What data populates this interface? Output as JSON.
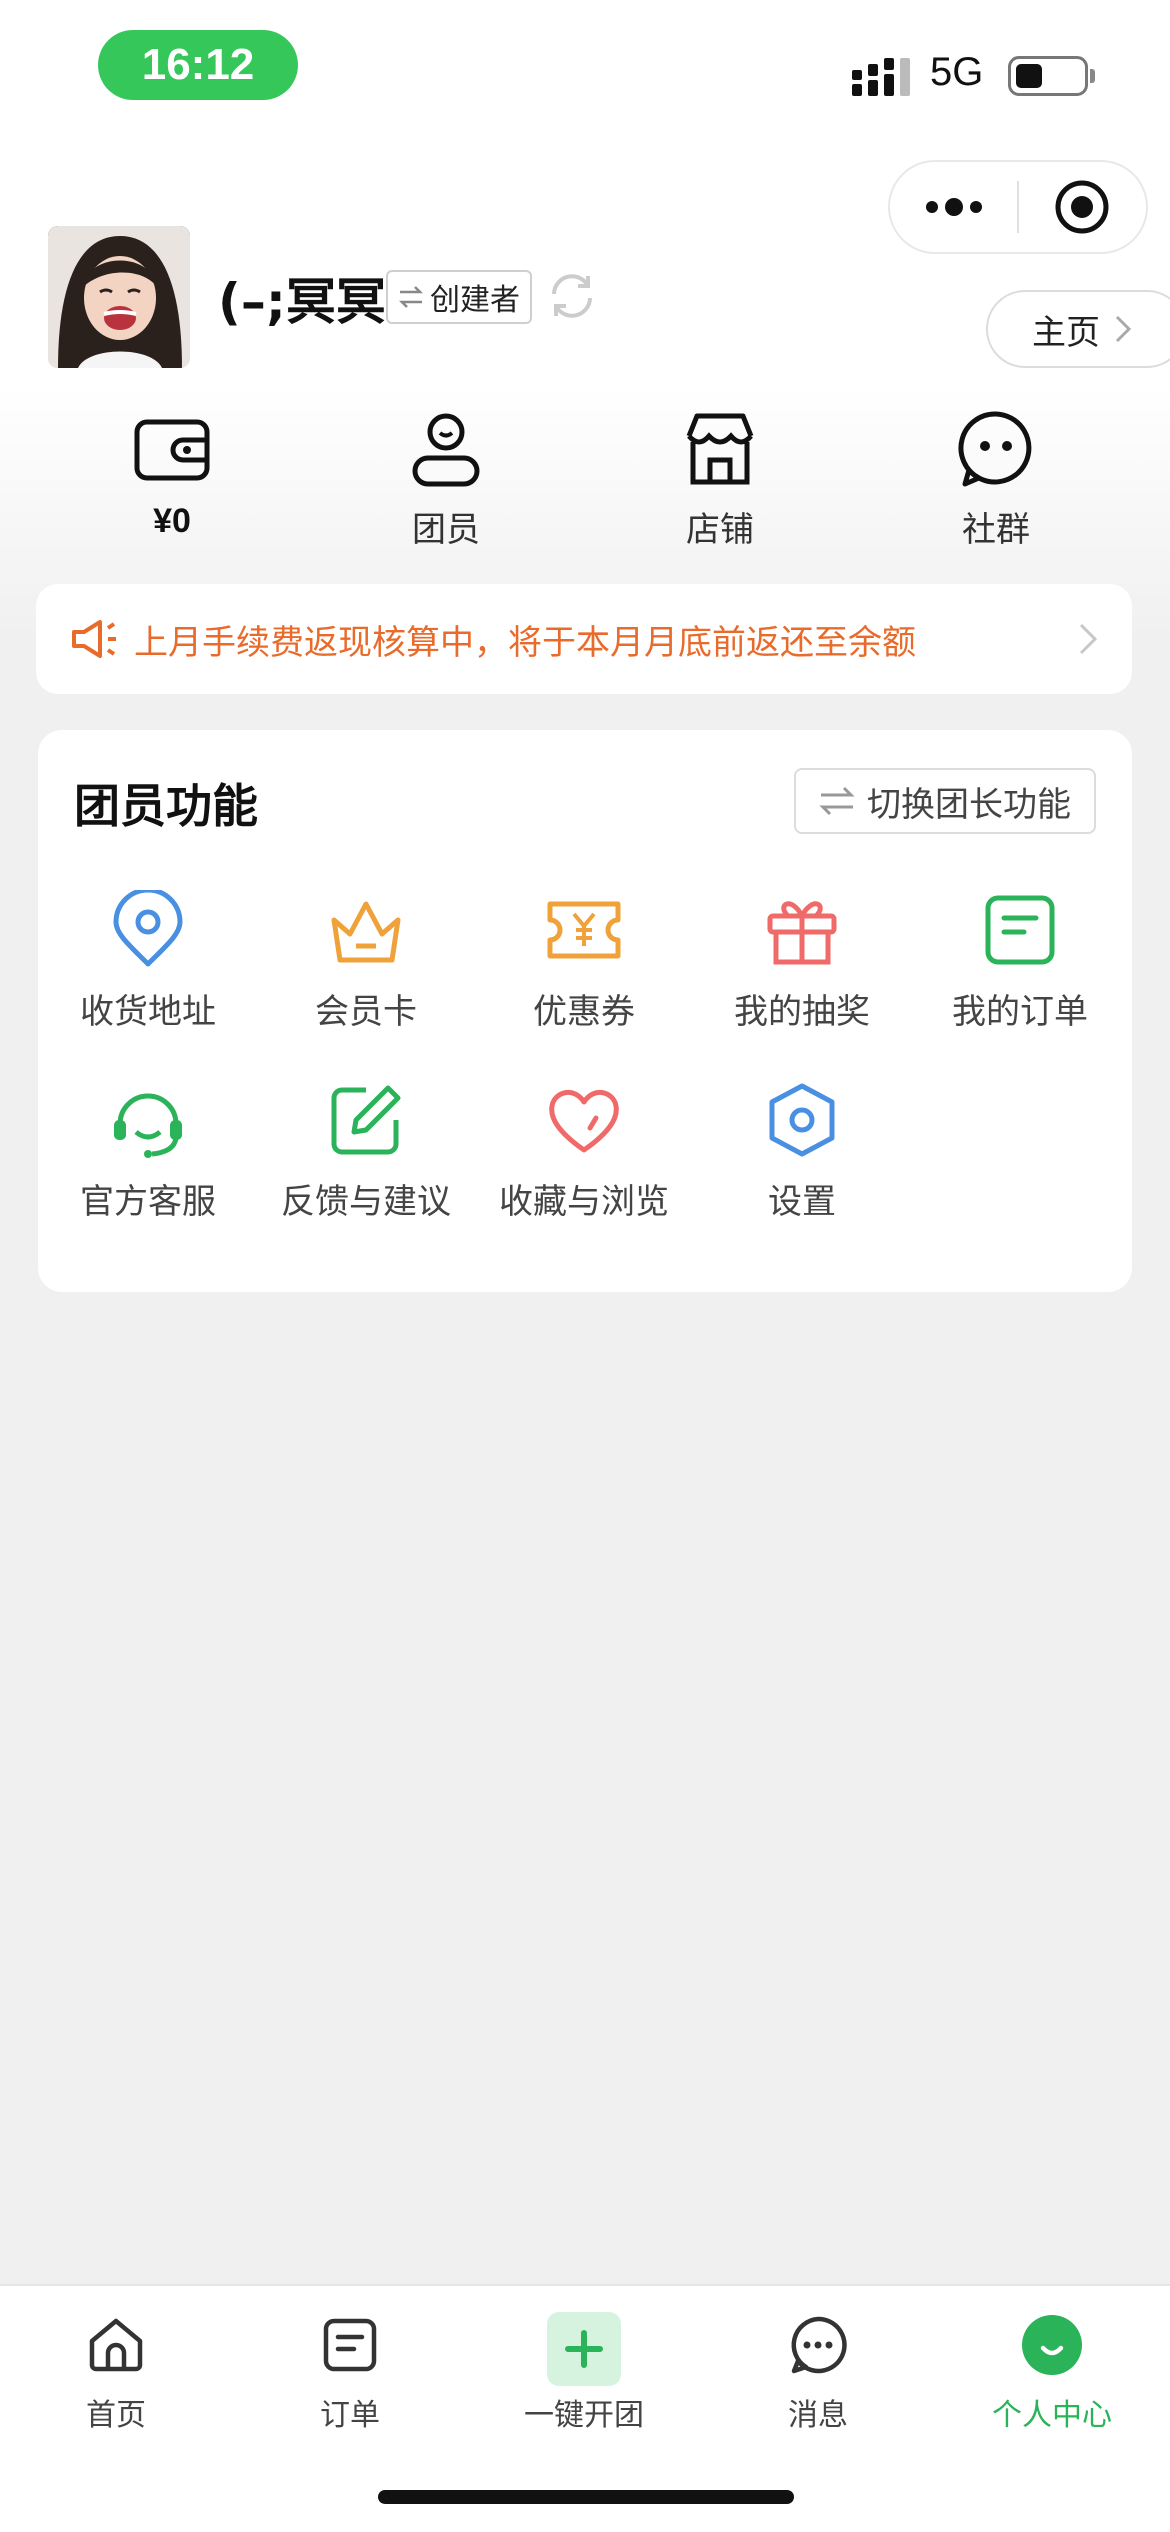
{
  "status_bar": {
    "time": "16:12",
    "network": "5G"
  },
  "profile": {
    "username": "(–;冥冥",
    "role_tag": "创建者",
    "homepage_label": "主页"
  },
  "quick_stats": [
    {
      "name": "wallet",
      "icon": "wallet-icon",
      "value": "¥0"
    },
    {
      "name": "members",
      "icon": "person-icon",
      "label": "团员"
    },
    {
      "name": "store",
      "icon": "store-icon",
      "label": "店铺"
    },
    {
      "name": "community",
      "icon": "chat-bubble-icon",
      "label": "社群"
    }
  ],
  "notice": {
    "text": "上月手续费返现核算中，将于本月月底前返还至余额",
    "color": "#e96b2c"
  },
  "functions": {
    "title": "团员功能",
    "switch_label": "切换团长功能",
    "items": [
      {
        "label": "收货地址",
        "icon": "location-pin-icon",
        "color": "#4a90e2"
      },
      {
        "label": "会员卡",
        "icon": "crown-icon",
        "color": "#f0a23a"
      },
      {
        "label": "优惠券",
        "icon": "coupon-icon",
        "color": "#f0a23a"
      },
      {
        "label": "我的抽奖",
        "icon": "gift-icon",
        "color": "#f06a6a"
      },
      {
        "label": "我的订单",
        "icon": "order-icon",
        "color": "#2bb35a"
      },
      {
        "label": "官方客服",
        "icon": "headset-icon",
        "color": "#2bb35a"
      },
      {
        "label": "反馈与建议",
        "icon": "edit-icon",
        "color": "#2bb35a"
      },
      {
        "label": "收藏与浏览",
        "icon": "heart-icon",
        "color": "#f06a6a"
      },
      {
        "label": "设置",
        "icon": "settings-hexagon-icon",
        "color": "#4a90e2"
      }
    ]
  },
  "tabbar": {
    "items": [
      {
        "label": "首页",
        "icon": "home-icon"
      },
      {
        "label": "订单",
        "icon": "order-icon"
      },
      {
        "label": "一键开团",
        "icon": "plus-icon"
      },
      {
        "label": "消息",
        "icon": "message-icon"
      },
      {
        "label": "个人中心",
        "icon": "profile-smile-icon",
        "active": true
      }
    ],
    "active_color": "#2bb35a"
  }
}
